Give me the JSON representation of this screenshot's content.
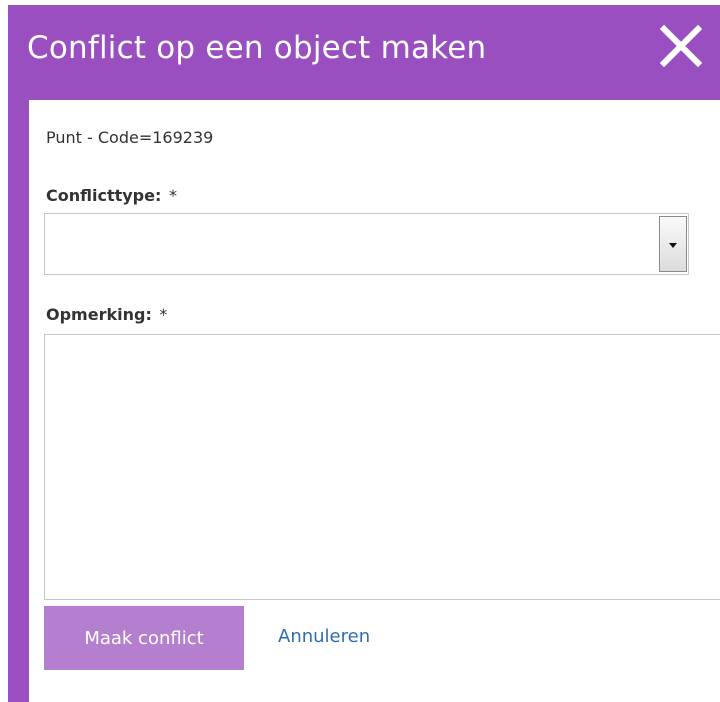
{
  "dialog": {
    "title": "Conflict op een object maken",
    "close_icon": "close-icon",
    "accent_color": "#9a4fc1"
  },
  "form": {
    "object_label": "Punt - Code=169239",
    "conflict_type": {
      "label": "Conflicttype:",
      "required_mark": "*",
      "value": ""
    },
    "remark": {
      "label": "Opmerking:",
      "required_mark": "*",
      "value": ""
    },
    "submit_label": "Maak conflict",
    "cancel_label": "Annuleren"
  }
}
